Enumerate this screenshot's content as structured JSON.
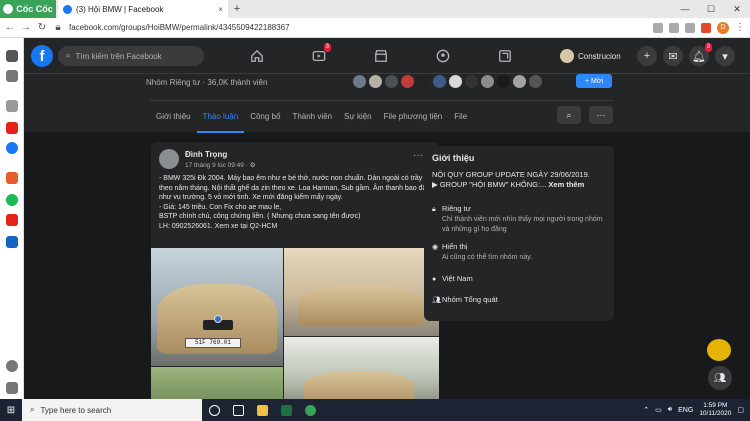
{
  "browser": {
    "brand": "Cốc Cốc",
    "tab_title": "(3) Hội BMW | Facebook",
    "tab_close": "×",
    "new_tab": "+",
    "url": "facebook.com/groups/HoiBMW/permalink/4345509422188367",
    "window_controls": [
      "—",
      "☐",
      "✕"
    ]
  },
  "fb_nav": {
    "logo": "f",
    "search_placeholder": "Tìm kiếm trên Facebook",
    "watch_badge": "3",
    "profile_name": "Construcion",
    "notif_badge": "3",
    "accent": "#1877f2"
  },
  "group": {
    "meta": "Nhóm Riêng tư · 36,0K thành viên",
    "join_label": "Mời",
    "tabs": [
      "Giới thiệu",
      "Thảo luận",
      "Công bố",
      "Thành viên",
      "Sự kiện",
      "File phương tiện",
      "File"
    ],
    "active_tab": "Thảo luận",
    "search_icon": "search-icon",
    "more_icon": "more-icon"
  },
  "post": {
    "author": "Đình Trọng",
    "time": "17 tháng 9 lúc 09:49 · ",
    "more": "···",
    "lines": [
      "- BMW 325i Đk 2004. Máy bao êm như e bé thở, nước non chuẩn. Dàn ngoài có trầy theo năm tháng. Nội thất ghế da zin theo xe. Loa Harman, Sub gầm. Âm thanh bao đập như vụ trường. 5 vỏ mới tinh. Xe mới đăng kiểm mấy ngày.",
      "- Giá: 145 triệu. Con Fix cho ae mau le,",
      "BSTP chính chủ, công chứng liền. ( Nhưng chưa sang tên được)",
      "LH: 0902526061. Xem xe tại Q2-HCM"
    ],
    "plate": "51F 769.01"
  },
  "about": {
    "heading": "Giới thiệu",
    "rule_text": "NỘI QUY GROUP UPDATE NGÀY 29/06/2019.",
    "rule_link": "▶ GROUP \"HỘI BMW\" KHÔNG:...",
    "see_more": "Xem thêm",
    "privacy_title": "Riêng tư",
    "privacy_desc": "Chỉ thành viên mới nhìn thấy mọi người trong nhóm và những gì họ đăng",
    "visible_title": "Hiển thị",
    "visible_desc": "Ai cũng có thể tìm nhóm này.",
    "location": "Việt Nam",
    "category": "Nhóm Tổng quát"
  },
  "taskbar": {
    "search_placeholder": "Type here to search",
    "lang": "ENG",
    "time": "1:59 PM",
    "date": "10/11/2020"
  }
}
